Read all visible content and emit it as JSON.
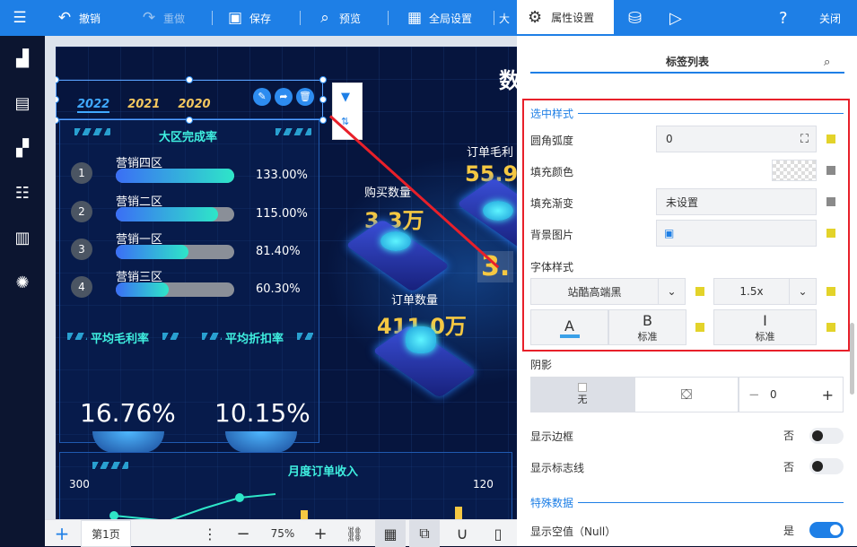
{
  "toolbar": {
    "undo": "撤销",
    "redo": "重做",
    "save": "保存",
    "preview": "预览",
    "global": "全局设置",
    "cut_text": "大"
  },
  "screen": {
    "title": "数",
    "tabs": [
      "2022",
      "2021",
      "2020"
    ],
    "panel_title": "大区完成率",
    "rows": [
      {
        "rank": "1",
        "name": "营销四区",
        "pct": "133.00%",
        "fill": 1.0
      },
      {
        "rank": "2",
        "name": "营销二区",
        "pct": "115.00%",
        "fill": 0.86
      },
      {
        "rank": "3",
        "name": "营销一区",
        "pct": "81.40%",
        "fill": 0.61
      },
      {
        "rank": "4",
        "name": "营销三区",
        "pct": "60.30%",
        "fill": 0.45
      }
    ],
    "avg_margin_label": "平均毛利率",
    "avg_discount_label": "平均折扣率",
    "avg_margin": "16.76%",
    "avg_discount": "10.15%",
    "monthly_title": "月度订单收入",
    "axis_left": "300",
    "axis_right": "120",
    "buy_label": "购买数量",
    "buy_value": "3.3万",
    "order_margin_label": "订单毛利",
    "order_margin_value": "55.9",
    "order_qty_label": "订单数量",
    "order_qty_value": "411.0万",
    "center_value": "3."
  },
  "bottombar": {
    "page_tab": "第1页",
    "zoom": "75%"
  },
  "rpanel": {
    "header_title": "属性设置",
    "close": "关闭",
    "tab": "标签列表",
    "selected_style": "选中样式",
    "radius_label": "圆角弧度",
    "radius_value": "0",
    "fill_color_label": "填充颜色",
    "fill_gradient_label": "填充渐变",
    "fill_gradient_value": "未设置",
    "bg_image_label": "背景图片",
    "font_style_label": "字体样式",
    "font_name": "站酷高端黑",
    "font_size": "1.5x",
    "btn_a": "A",
    "btn_b": "B",
    "btn_b_sub": "标准",
    "btn_i": "I",
    "btn_i_sub": "标准",
    "shadow_label": "阴影",
    "shadow_none": "无",
    "shadow_value": "0",
    "show_border_label": "显示边框",
    "show_border_value": "否",
    "show_marker_label": "显示标志线",
    "show_marker_value": "否",
    "special_data": "特殊数据",
    "show_null_label": "显示空值（Null）",
    "show_null_value": "是"
  },
  "colors": {
    "accent": "#1e7fe6",
    "highlight": "#e8202a",
    "swatch": "#e3d32a"
  }
}
